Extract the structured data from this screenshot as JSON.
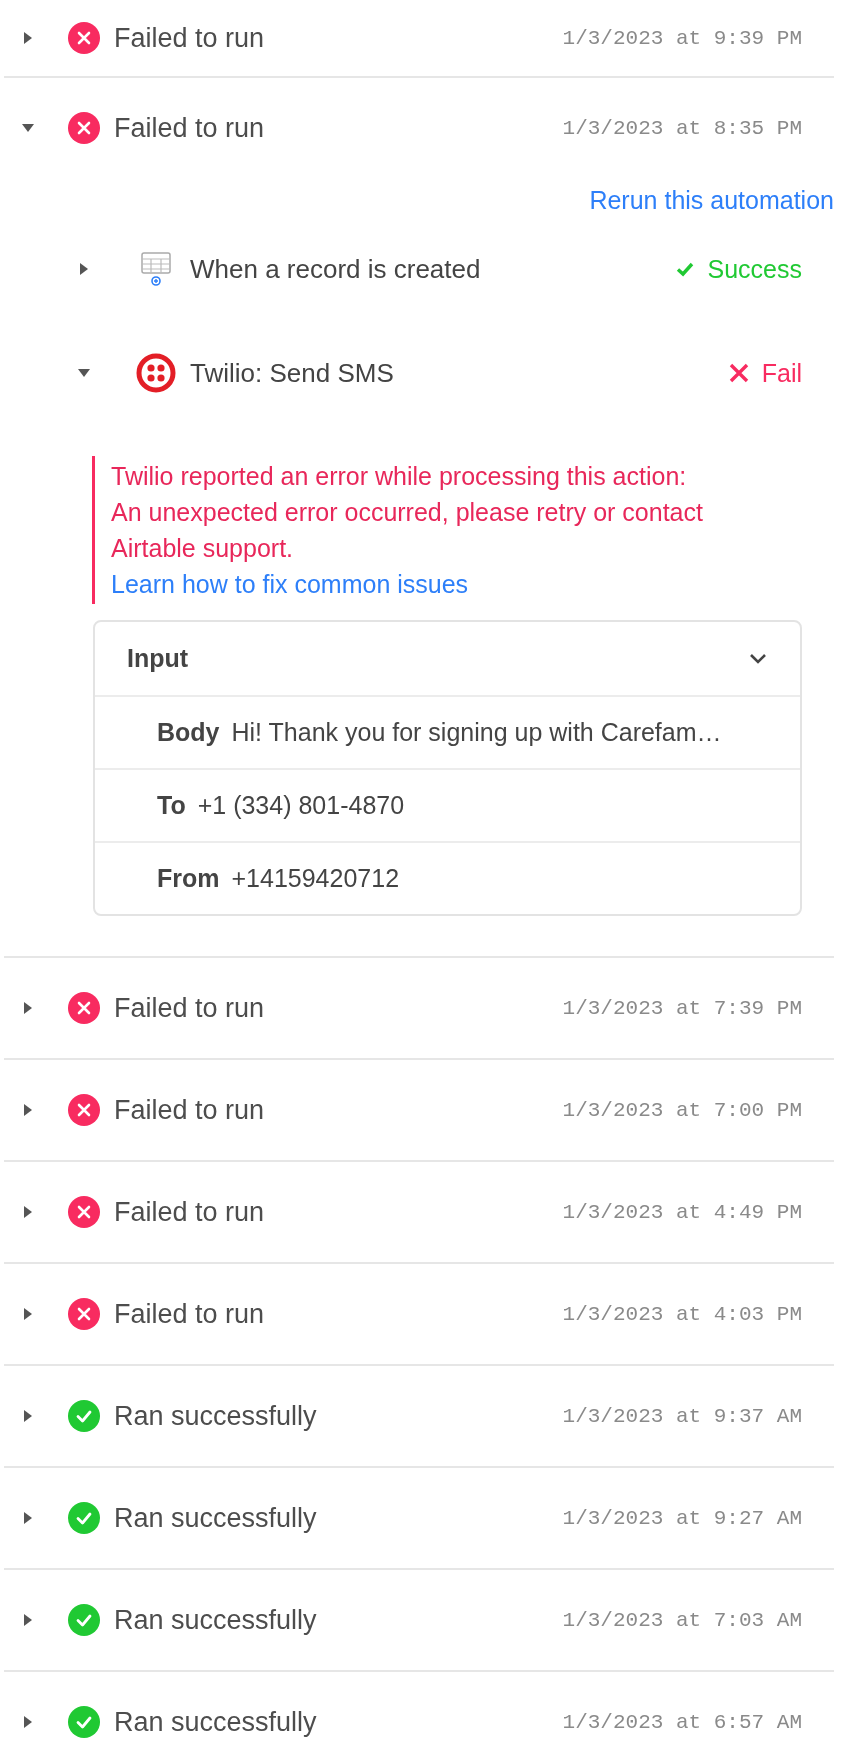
{
  "runs": [
    {
      "failed": true,
      "label": "Failed to run",
      "time": "1/3/2023 at 9:39 PM",
      "expanded": false
    },
    {
      "failed": true,
      "label": "Failed to run",
      "time": "1/3/2023 at 8:35 PM",
      "expanded": true,
      "rerun_link": "Rerun this automation",
      "steps": [
        {
          "kind": "trigger",
          "name": "When a record is created",
          "failed": false,
          "result": "Success",
          "expanded": false
        },
        {
          "kind": "action",
          "name": "Twilio: Send SMS",
          "failed": true,
          "result": "Fail",
          "expanded": true,
          "error": [
            "Twilio reported an error while processing this action:",
            "An unexpected error occurred, please retry or contact",
            "Airtable support."
          ],
          "help_link": "Learn how to fix common issues",
          "input": {
            "title": "Input",
            "expanded": true,
            "fields": [
              {
                "label": "Body",
                "value": "Hi! Thank you for signing up with Carefam…"
              },
              {
                "label": "To",
                "value": "+1 (334) 801-4870"
              },
              {
                "label": "From",
                "value": "+14159420712"
              }
            ]
          }
        }
      ]
    },
    {
      "failed": true,
      "label": "Failed to run",
      "time": "1/3/2023 at 7:39 PM",
      "expanded": false
    },
    {
      "failed": true,
      "label": "Failed to run",
      "time": "1/3/2023 at 7:00 PM",
      "expanded": false
    },
    {
      "failed": true,
      "label": "Failed to run",
      "time": "1/3/2023 at 4:49 PM",
      "expanded": false
    },
    {
      "failed": true,
      "label": "Failed to run",
      "time": "1/3/2023 at 4:03 PM",
      "expanded": false
    },
    {
      "failed": false,
      "label": "Ran successfully",
      "time": "1/3/2023 at 9:37 AM",
      "expanded": false
    },
    {
      "failed": false,
      "label": "Ran successfully",
      "time": "1/3/2023 at 9:27 AM",
      "expanded": false
    },
    {
      "failed": false,
      "label": "Ran successfully",
      "time": "1/3/2023 at 7:03 AM",
      "expanded": false
    },
    {
      "failed": false,
      "label": "Ran successfully",
      "time": "1/3/2023 at 6:57 AM",
      "expanded": false
    }
  ]
}
